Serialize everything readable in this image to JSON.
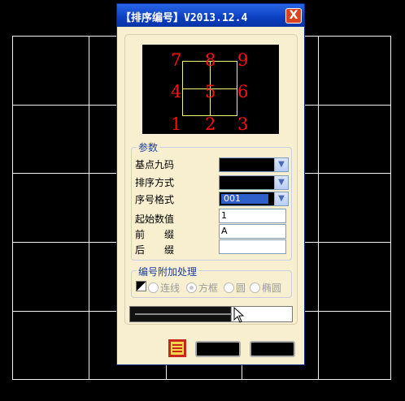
{
  "window": {
    "title": "【排序编号】V2013.12.4",
    "close_label": "X"
  },
  "preview": {
    "grid_numbers": [
      {
        "label": "7"
      },
      {
        "label": "8"
      },
      {
        "label": "9"
      },
      {
        "label": "4"
      },
      {
        "label": "5"
      },
      {
        "label": "6"
      },
      {
        "label": "1"
      },
      {
        "label": "2"
      },
      {
        "label": "3"
      }
    ],
    "frame_color": "#f0f07a",
    "number_color": "#ff1010"
  },
  "params": {
    "group_title": "参数",
    "base_point_label": "基点九码",
    "sort_mode_label": "排序方式",
    "seq_format_label": "序号格式",
    "seq_format_value": "001",
    "start_value_label": "起始数值",
    "start_value": "1",
    "prefix_label": "前　　缀",
    "prefix_value": "A",
    "suffix_label": "后　　缀",
    "suffix_value": ""
  },
  "extra": {
    "group_title": "编号附加处理",
    "options": [
      {
        "label": "连线",
        "checked": false
      },
      {
        "label": "方框",
        "checked": true
      },
      {
        "label": "圆",
        "checked": false
      },
      {
        "label": "椭圆",
        "checked": false
      }
    ]
  }
}
